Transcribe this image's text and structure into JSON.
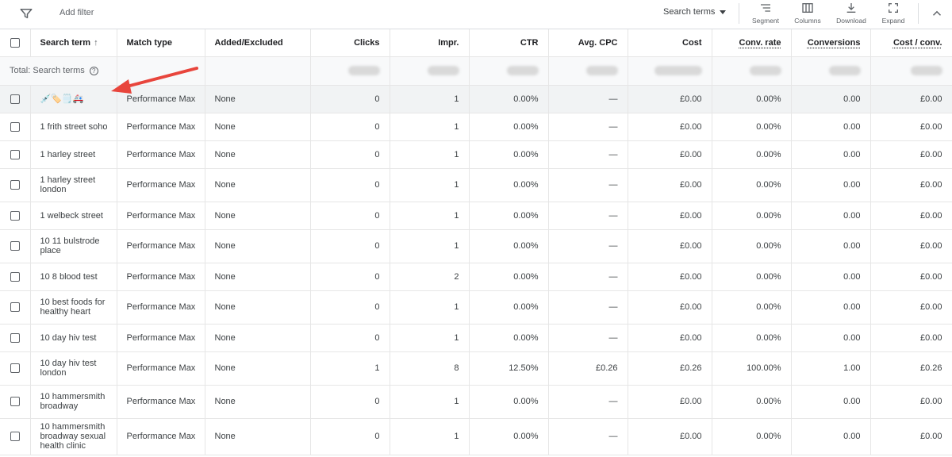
{
  "toolbar": {
    "add_filter_label": "Add filter",
    "segment_select_label": "Search terms",
    "buttons": [
      {
        "label": "Segment",
        "icon": "segment-icon"
      },
      {
        "label": "Columns",
        "icon": "columns-icon"
      },
      {
        "label": "Download",
        "icon": "download-icon"
      },
      {
        "label": "Expand",
        "icon": "expand-icon"
      }
    ]
  },
  "table": {
    "columns": [
      {
        "label": "Search term",
        "sorted": "ascending"
      },
      {
        "label": "Match type"
      },
      {
        "label": "Added/Excluded"
      },
      {
        "label": "Clicks"
      },
      {
        "label": "Impr."
      },
      {
        "label": "CTR"
      },
      {
        "label": "Avg. CPC"
      },
      {
        "label": "Cost"
      },
      {
        "label": "Conv. rate"
      },
      {
        "label": "Conversions"
      },
      {
        "label": "Cost / conv."
      }
    ],
    "total_label": "Total: Search terms",
    "rows": [
      {
        "term": "💉🏷️🗒️🚑",
        "match": "Performance Max",
        "added": "None",
        "clicks": "0",
        "impr": "1",
        "ctr": "0.00%",
        "cpc": "—",
        "cost": "£0.00",
        "conv_rate": "0.00%",
        "conversions": "0.00",
        "cost_conv": "£0.00"
      },
      {
        "term": "1 frith street soho",
        "match": "Performance Max",
        "added": "None",
        "clicks": "0",
        "impr": "1",
        "ctr": "0.00%",
        "cpc": "—",
        "cost": "£0.00",
        "conv_rate": "0.00%",
        "conversions": "0.00",
        "cost_conv": "£0.00"
      },
      {
        "term": "1 harley street",
        "match": "Performance Max",
        "added": "None",
        "clicks": "0",
        "impr": "1",
        "ctr": "0.00%",
        "cpc": "—",
        "cost": "£0.00",
        "conv_rate": "0.00%",
        "conversions": "0.00",
        "cost_conv": "£0.00"
      },
      {
        "term": "1 harley street london",
        "match": "Performance Max",
        "added": "None",
        "clicks": "0",
        "impr": "1",
        "ctr": "0.00%",
        "cpc": "—",
        "cost": "£0.00",
        "conv_rate": "0.00%",
        "conversions": "0.00",
        "cost_conv": "£0.00"
      },
      {
        "term": "1 welbeck street",
        "match": "Performance Max",
        "added": "None",
        "clicks": "0",
        "impr": "1",
        "ctr": "0.00%",
        "cpc": "—",
        "cost": "£0.00",
        "conv_rate": "0.00%",
        "conversions": "0.00",
        "cost_conv": "£0.00"
      },
      {
        "term": "10 11 bulstrode place",
        "match": "Performance Max",
        "added": "None",
        "clicks": "0",
        "impr": "1",
        "ctr": "0.00%",
        "cpc": "—",
        "cost": "£0.00",
        "conv_rate": "0.00%",
        "conversions": "0.00",
        "cost_conv": "£0.00"
      },
      {
        "term": "10 8 blood test",
        "match": "Performance Max",
        "added": "None",
        "clicks": "0",
        "impr": "2",
        "ctr": "0.00%",
        "cpc": "—",
        "cost": "£0.00",
        "conv_rate": "0.00%",
        "conversions": "0.00",
        "cost_conv": "£0.00"
      },
      {
        "term": "10 best foods for healthy heart",
        "match": "Performance Max",
        "added": "None",
        "clicks": "0",
        "impr": "1",
        "ctr": "0.00%",
        "cpc": "—",
        "cost": "£0.00",
        "conv_rate": "0.00%",
        "conversions": "0.00",
        "cost_conv": "£0.00"
      },
      {
        "term": "10 day hiv test",
        "match": "Performance Max",
        "added": "None",
        "clicks": "0",
        "impr": "1",
        "ctr": "0.00%",
        "cpc": "—",
        "cost": "£0.00",
        "conv_rate": "0.00%",
        "conversions": "0.00",
        "cost_conv": "£0.00"
      },
      {
        "term": "10 day hiv test london",
        "match": "Performance Max",
        "added": "None",
        "clicks": "1",
        "impr": "8",
        "ctr": "12.50%",
        "cpc": "£0.26",
        "cost": "£0.26",
        "conv_rate": "100.00%",
        "conversions": "1.00",
        "cost_conv": "£0.26"
      },
      {
        "term": "10 hammersmith broadway",
        "match": "Performance Max",
        "added": "None",
        "clicks": "0",
        "impr": "1",
        "ctr": "0.00%",
        "cpc": "—",
        "cost": "£0.00",
        "conv_rate": "0.00%",
        "conversions": "0.00",
        "cost_conv": "£0.00"
      },
      {
        "term": "10 hammersmith broadway sexual health clinic",
        "match": "Performance Max",
        "added": "None",
        "clicks": "0",
        "impr": "1",
        "ctr": "0.00%",
        "cpc": "—",
        "cost": "£0.00",
        "conv_rate": "0.00%",
        "conversions": "0.00",
        "cost_conv": "£0.00"
      }
    ]
  },
  "colors": {
    "arrow": "#e8453c",
    "total_bg": "#f8f9fa",
    "highlight_bg": "#f1f3f4",
    "border": "#e6e6e6"
  }
}
